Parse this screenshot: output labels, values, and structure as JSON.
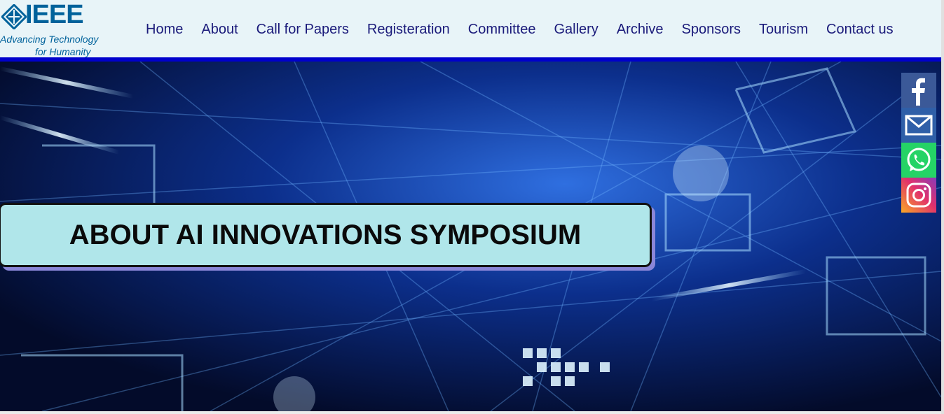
{
  "logo": {
    "name": "IEEE",
    "tagline_line1": "Advancing Technology",
    "tagline_line2": "for Humanity"
  },
  "nav": {
    "items": [
      "Home",
      "About",
      "Call for Papers",
      "Registeration",
      "Committee",
      "Gallery",
      "Archive",
      "Sponsors",
      "Tourism",
      "Contact us"
    ]
  },
  "hero": {
    "title": "ABOUT AI INNOVATIONS SYMPOSIUM"
  },
  "social": {
    "icons": [
      "facebook-icon",
      "mail-icon",
      "whatsapp-icon",
      "instagram-icon"
    ]
  },
  "colors": {
    "nav_text": "#1a1a7a",
    "accent_bar": "#0000cc",
    "title_box": "#b0e6ea",
    "ieee_blue": "#00629b"
  }
}
